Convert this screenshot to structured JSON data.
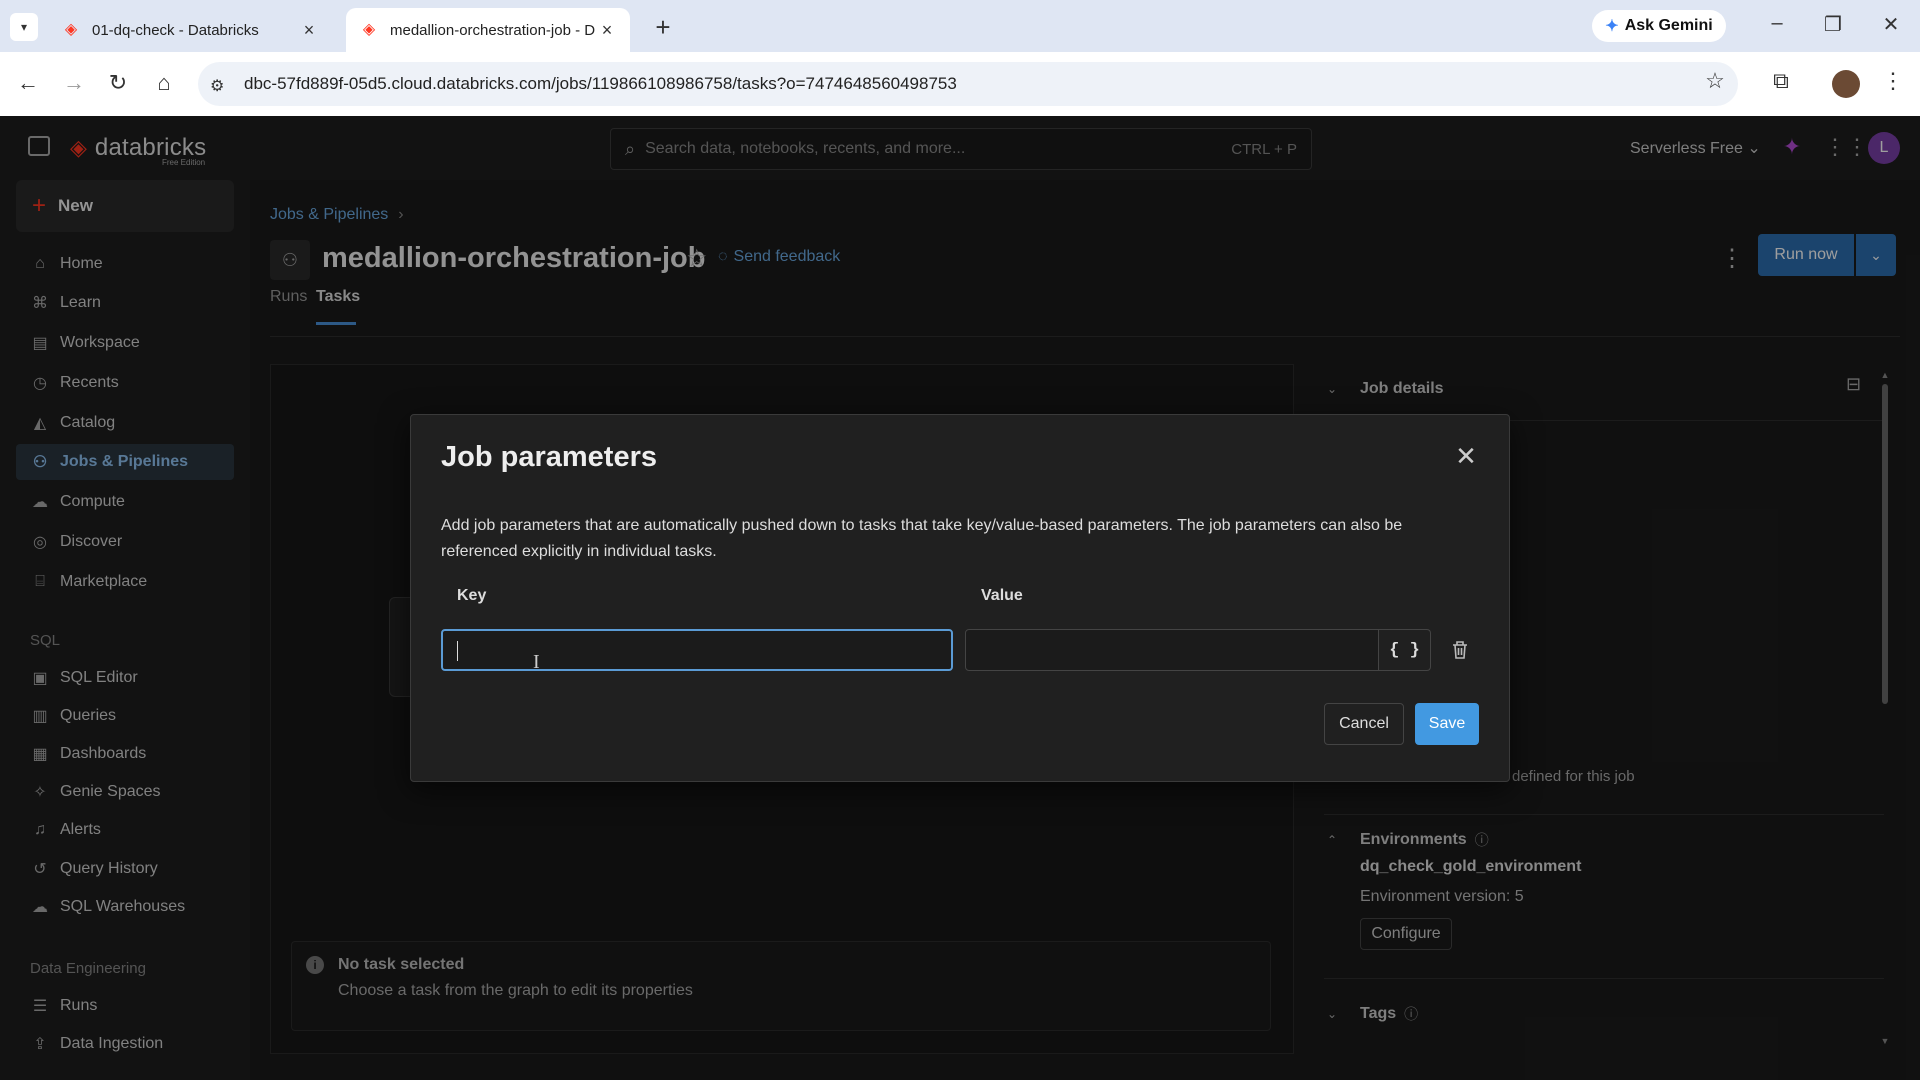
{
  "browser": {
    "tabs": [
      {
        "title": "01-dq-check - Databricks",
        "active": false
      },
      {
        "title": "medallion-orchestration-job - D",
        "active": true
      }
    ],
    "gemini_label": "Ask Gemini",
    "url": "dbc-57fd889f-05d5.cloud.databricks.com/jobs/119866108986758/tasks?o=7474648560498753"
  },
  "header": {
    "logo_text": "databricks",
    "logo_sub": "Free Edition",
    "search_placeholder": "Search data, notebooks, recents, and more...",
    "search_shortcut": "CTRL + P",
    "workspace": "Serverless Free",
    "avatar_letter": "L"
  },
  "sidebar": {
    "new_label": "New",
    "items": [
      {
        "label": "Home",
        "icon": "home-icon"
      },
      {
        "label": "Learn",
        "icon": "learn-icon"
      },
      {
        "label": "Workspace",
        "icon": "workspace-icon"
      },
      {
        "label": "Recents",
        "icon": "clock-icon"
      },
      {
        "label": "Catalog",
        "icon": "catalog-icon"
      },
      {
        "label": "Jobs & Pipelines",
        "icon": "jobs-icon",
        "active": true
      },
      {
        "label": "Compute",
        "icon": "cloud-icon"
      },
      {
        "label": "Discover",
        "icon": "compass-icon"
      },
      {
        "label": "Marketplace",
        "icon": "marketplace-icon"
      }
    ],
    "sql_section": "SQL",
    "sql_items": [
      {
        "label": "SQL Editor"
      },
      {
        "label": "Queries"
      },
      {
        "label": "Dashboards"
      },
      {
        "label": "Genie Spaces"
      },
      {
        "label": "Alerts"
      },
      {
        "label": "Query History"
      },
      {
        "label": "SQL Warehouses"
      }
    ],
    "de_section": "Data Engineering",
    "de_items": [
      {
        "label": "Runs"
      },
      {
        "label": "Data Ingestion"
      }
    ]
  },
  "page": {
    "breadcrumb": "Jobs & Pipelines",
    "job_title": "medallion-orchestration-job",
    "feedback_label": "Send feedback",
    "run_now_label": "Run now",
    "tabs": [
      {
        "label": "Runs",
        "selected": false
      },
      {
        "label": "Tasks",
        "selected": true
      }
    ],
    "no_task_title": "No task selected",
    "no_task_sub": "Choose a task from the graph to edit its properties"
  },
  "right_panel": {
    "job_details_label": "Job details",
    "partial_text": "defined for this job",
    "environments_label": "Environments",
    "env_name": "dq_check_gold_environment",
    "env_version": "Environment version: 5",
    "configure_label": "Configure",
    "tags_label": "Tags"
  },
  "modal": {
    "title": "Job parameters",
    "description": "Add job parameters that are automatically pushed down to tasks that take key/value-based parameters. The job parameters can also be referenced explicitly in individual tasks.",
    "key_label": "Key",
    "value_label": "Value",
    "key_value": "",
    "value_value": "",
    "dynamic_value_glyph": "{ }",
    "cancel_label": "Cancel",
    "save_label": "Save"
  },
  "colors": {
    "accent": "#4299e1",
    "run_button": "#2d6fb0",
    "brand": "#ff3621",
    "active_nav": "#8fc2f2"
  }
}
